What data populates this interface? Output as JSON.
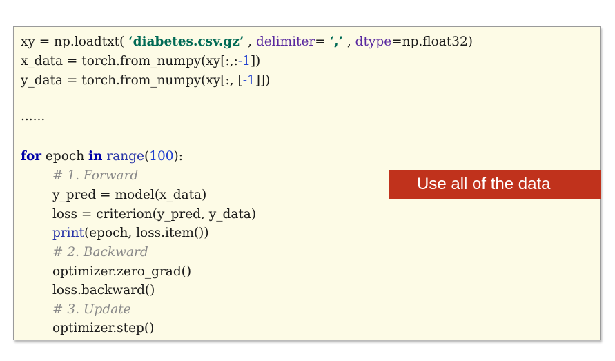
{
  "code": {
    "line1": {
      "p1": "xy = np.loadtxt( ",
      "str1": "‘diabetes.csv.gz’",
      "p2": " , ",
      "param1": "delimiter",
      "p3": "= ",
      "str2": "‘,’",
      "p4": " , ",
      "param2": "dtype",
      "p5": "=np.float32)"
    },
    "line2": {
      "p1": "x_data = torch.from_numpy(xy[:,:",
      "num1": "-1",
      "p2": "])"
    },
    "line3": {
      "p1": "y_data = torch.from_numpy(xy[:, [",
      "num1": "-1",
      "p2": "]])"
    },
    "ellipsis": "......",
    "loop": {
      "kw_for": "for",
      "p1": " epoch ",
      "kw_in": "in",
      "p2": " ",
      "fn_range": "range",
      "p3": "(",
      "num1": "100",
      "p4": "):"
    },
    "comment1": "# 1. Forward",
    "line_pred": "y_pred = model(x_data)",
    "line_loss": "loss = criterion(y_pred, y_data)",
    "print_line": {
      "fn_print": "print",
      "p1": "(epoch, loss.item())"
    },
    "comment2": "# 2. Backward",
    "line_zero": "optimizer.zero_grad()",
    "line_backward": "loss.backward()",
    "comment3": "# 3. Update",
    "line_step": "optimizer.step()"
  },
  "callout": {
    "text": "Use all of the data"
  },
  "colors": {
    "panel_bg": "#fdfbe6",
    "callout_bg": "#c0321c",
    "keyword": "#0000a8",
    "string": "#006a55",
    "comment": "#8a8a8a"
  }
}
